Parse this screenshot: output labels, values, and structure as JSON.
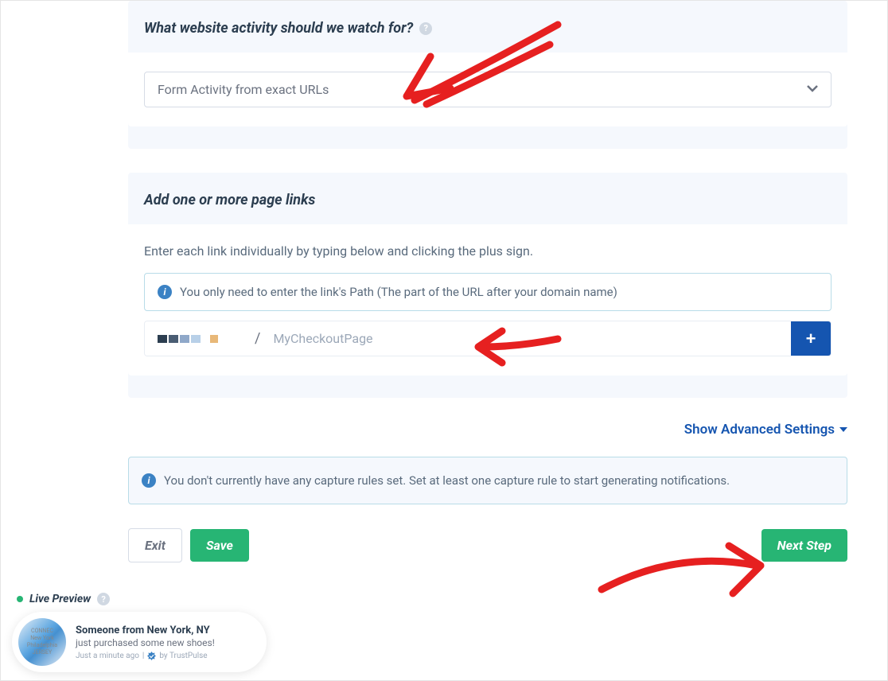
{
  "section1": {
    "title": "What website activity should we watch for?",
    "select_value": "Form Activity from exact URLs"
  },
  "section2": {
    "title": "Add one or more page links",
    "instruction": "Enter each link individually by typing below and clicking the plus sign.",
    "info_text": "You only need to enter the link's Path (The part of the URL after your domain name)",
    "slash": "/",
    "placeholder": "MyCheckoutPage",
    "add_symbol": "+"
  },
  "advanced": {
    "label": "Show Advanced Settings"
  },
  "alert": {
    "text": "You don't currently have any capture rules set. Set at least one capture rule to start generating notifications."
  },
  "buttons": {
    "exit": "Exit",
    "save": "Save",
    "next": "Next Step"
  },
  "preview": {
    "label": "Live Preview",
    "headline": "Someone from New York, NY",
    "sub": "just purchased some new shoes!",
    "time": "Just a minute ago",
    "by": "by TrustPulse",
    "map_labels": "New York\nPhiladelphia"
  }
}
